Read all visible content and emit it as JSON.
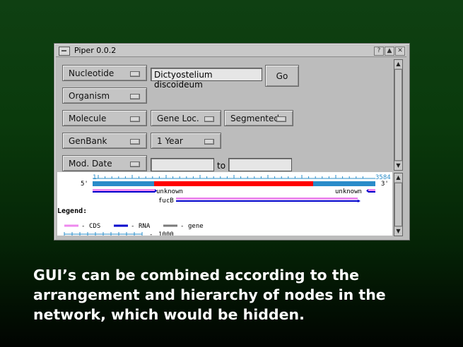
{
  "window": {
    "title": "Piper 0.0.2",
    "controls": [
      "?",
      "▲",
      "✕"
    ]
  },
  "form": {
    "nucleotide_label": "Nucleotide",
    "organism_value": "Dictyostelium discoideum",
    "go_label": "Go",
    "organism_label": "Organism",
    "molecule_label": "Molecule",
    "gene_loc_label": "Gene Loc.",
    "segmented_label": "Segmented",
    "genbank_label": "GenBank",
    "year_value": "1 Year",
    "mod_date_label": "Mod. Date",
    "date_from": "",
    "to_label": "to",
    "date_to": ""
  },
  "map": {
    "start_label": "1",
    "end_label": "3584",
    "five_prime": "5'",
    "three_prime": "3'",
    "gene_left": "unknown",
    "gene_right": "unknown",
    "gene_middle": "fucB",
    "legend_title": "Legend:",
    "legend_cds": "CDS",
    "legend_rna": "RNA",
    "legend_gene": "gene",
    "scale_label": "1000",
    "colors": {
      "sequence": "#2a8cc9",
      "cds_region": "#ff0000",
      "cds": "#ee88ee",
      "rna": "#0000cc",
      "gene": "#7a7a7a"
    }
  },
  "caption": [
    "GUI’s can be combined according to the",
    "arrangement and hierarchy of nodes in the",
    "network, which would be hidden."
  ]
}
